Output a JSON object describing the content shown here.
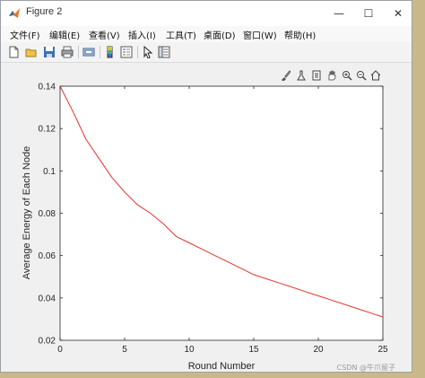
{
  "window": {
    "title": "Figure 2",
    "controls": {
      "minimize": "—",
      "maximize": "☐",
      "close": "✕"
    }
  },
  "menu": {
    "items": [
      "文件(F)",
      "编辑(E)",
      "查看(V)",
      "插入(I)",
      "工具(T)",
      "桌面(D)",
      "窗口(W)",
      "帮助(H)"
    ]
  },
  "toolbar": {
    "icons": [
      "new-figure-icon",
      "open-icon",
      "save-icon",
      "print-icon",
      "link-icon",
      "colorbar-icon",
      "legend-icon",
      "pointer-icon",
      "property-inspector-icon"
    ]
  },
  "axes_toolbar": {
    "icons": [
      "brush-icon",
      "data-tip-icon",
      "datatip-table-icon",
      "pan-icon",
      "zoom-in-icon",
      "zoom-out-icon",
      "home-icon"
    ]
  },
  "chart_data": {
    "type": "line",
    "xlabel": "Round Number",
    "ylabel": "Average Energy of Each Node",
    "xlim": [
      0,
      25
    ],
    "ylim": [
      0.02,
      0.14
    ],
    "xticks": [
      0,
      5,
      10,
      15,
      20,
      25
    ],
    "yticks": [
      0.02,
      0.04,
      0.06,
      0.08,
      0.1,
      0.12,
      0.14
    ],
    "ytick_labels": [
      "0.02",
      "0.04",
      "0.06",
      "0.08",
      "0.1",
      "0.12",
      "0.14"
    ],
    "grid": false,
    "series": [
      {
        "color": "#e8312f",
        "x": [
          0,
          1,
          2,
          3,
          4,
          5,
          6,
          7,
          8,
          9,
          10,
          11,
          12,
          13,
          14,
          15,
          16,
          17,
          18,
          19,
          20,
          21,
          22,
          23,
          24,
          25
        ],
        "y": [
          0.14,
          0.128,
          0.115,
          0.106,
          0.097,
          0.09,
          0.084,
          0.08,
          0.075,
          0.069,
          0.066,
          0.063,
          0.06,
          0.057,
          0.054,
          0.051,
          0.049,
          0.047,
          0.045,
          0.043,
          0.041,
          0.039,
          0.037,
          0.035,
          0.033,
          0.031
        ]
      }
    ]
  },
  "watermark": "CSDN @牛爪留子"
}
